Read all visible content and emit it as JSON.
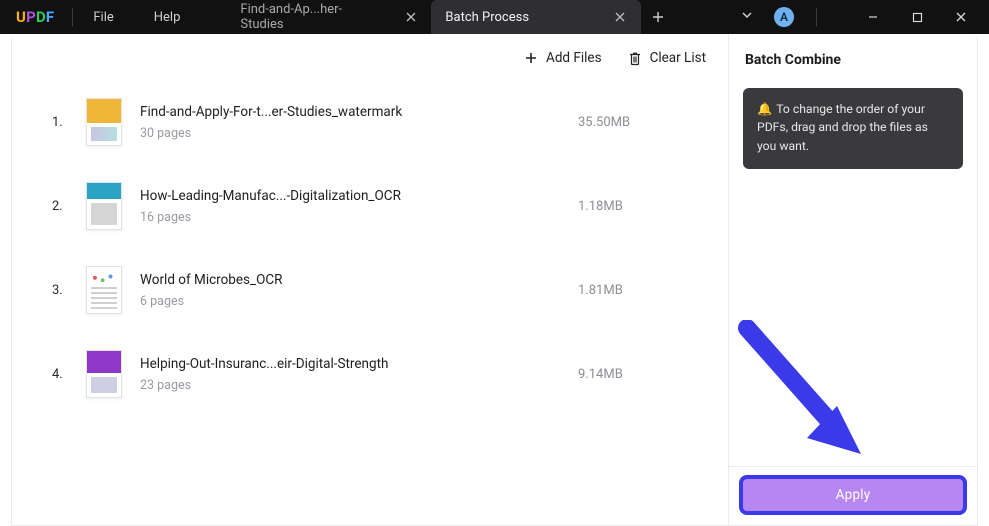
{
  "menu": {
    "file": "File",
    "help": "Help"
  },
  "tabs": {
    "inactive": {
      "label": "Find-and-Ap...her-Studies"
    },
    "active": {
      "label": "Batch Process"
    }
  },
  "avatar": {
    "initial": "A"
  },
  "toolbar": {
    "add_files": "Add Files",
    "clear_list": "Clear List"
  },
  "files": [
    {
      "num": "1.",
      "name": "Find-and-Apply-For-t...er-Studies_watermark",
      "pages": "30 pages",
      "size": "35.50MB"
    },
    {
      "num": "2.",
      "name": "How-Leading-Manufac...-Digitalization_OCR",
      "pages": "16 pages",
      "size": "1.18MB"
    },
    {
      "num": "3.",
      "name": "World of Microbes_OCR",
      "pages": "6 pages",
      "size": "1.81MB"
    },
    {
      "num": "4.",
      "name": "Helping-Out-Insuranc...eir-Digital-Strength",
      "pages": "23 pages",
      "size": "9.14MB"
    }
  ],
  "panel": {
    "title": "Batch Combine",
    "hint": "To change the order of your PDFs, drag and drop the files as you want.",
    "apply": "Apply"
  }
}
